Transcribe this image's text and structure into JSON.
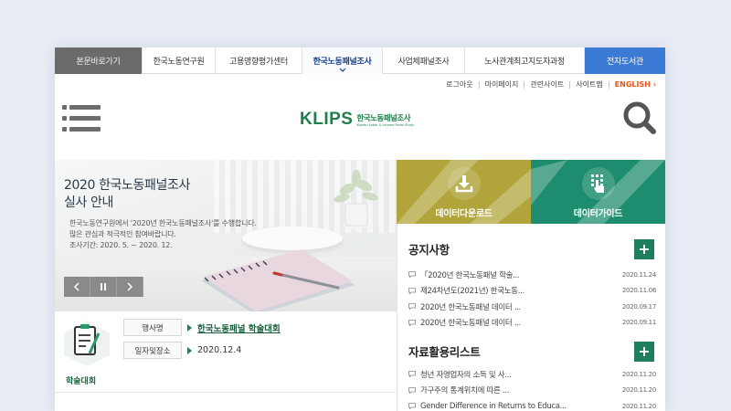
{
  "topnav": [
    {
      "label": "본문바로가기",
      "kind": "skip"
    },
    {
      "label": "한국노동연구원",
      "kind": "normal"
    },
    {
      "label": "고용영향평가센터",
      "kind": "normal"
    },
    {
      "label": "한국노동패널조사",
      "kind": "active"
    },
    {
      "label": "사업체패널조사",
      "kind": "normal"
    },
    {
      "label": "노사관계최고지도자과정",
      "kind": "normal"
    },
    {
      "label": "전자도서관",
      "kind": "library"
    }
  ],
  "utility": {
    "logout": "로그아웃",
    "mypage": "마이페이지",
    "related": "관련사이트",
    "sitemap": "사이트맵",
    "english": "ENGLISH ›"
  },
  "logo": {
    "main": "KLIPS",
    "sub_kr": "한국노동패널조사",
    "sub_en": "Korean Labor & Income Panel Study"
  },
  "hero": {
    "title_line1": "2020 한국노동패널조사",
    "title_line2": "실사 안내",
    "desc_line1": "한국노동연구원에서 '2020년 한국노동패널조사'를 수행합니다.",
    "desc_line2": "많은 관심과 적극적인 참여바랍니다.",
    "desc_line3": "조사기간: 2020. 5. ~ 2020. 12."
  },
  "event": {
    "icon_label": "학술대회",
    "name_key": "행사명",
    "name_value": "한국노동패널 학술대회",
    "place_key": "일자및장소",
    "place_value": "2020.12.4"
  },
  "tiles": {
    "download": "데이터다운로드",
    "guide": "데이터가이드"
  },
  "notice": {
    "title": "공지사항",
    "plus": "+",
    "items": [
      {
        "title": "「2020년 한국노동패널 학술...",
        "date": "2020.11.24"
      },
      {
        "title": "제24차년도(2021년) 한국노동...",
        "date": "2020.11.06"
      },
      {
        "title": "2020년 한국노동패널 데이터 ...",
        "date": "2020.09.17"
      },
      {
        "title": "2020년 한국노동패널 데이터 ...",
        "date": "2020.09.11"
      }
    ]
  },
  "data_list": {
    "title": "자료활용리스트",
    "plus": "+",
    "items": [
      {
        "title": "청년 자영업자의 소득 및 사...",
        "date": "2020.11.20"
      },
      {
        "title": "가구주의 통계위치에 따른 ...",
        "date": "2020.11.20"
      },
      {
        "title": "Gender Difference in Returns to Educa...",
        "date": "2020.11.20"
      }
    ]
  },
  "colors": {
    "accent_green": "#1e7f5a",
    "tile_olive": "#b0a43a",
    "tile_teal": "#1e8c6e",
    "library_blue": "#3b7bd6",
    "english_orange": "#e9531e"
  },
  "icons": [
    "hamburger-icon",
    "search-icon",
    "download-icon",
    "touch-guide-icon",
    "chat-bubble-icon",
    "clipboard-pencil-icon",
    "chevron-down-icon"
  ]
}
